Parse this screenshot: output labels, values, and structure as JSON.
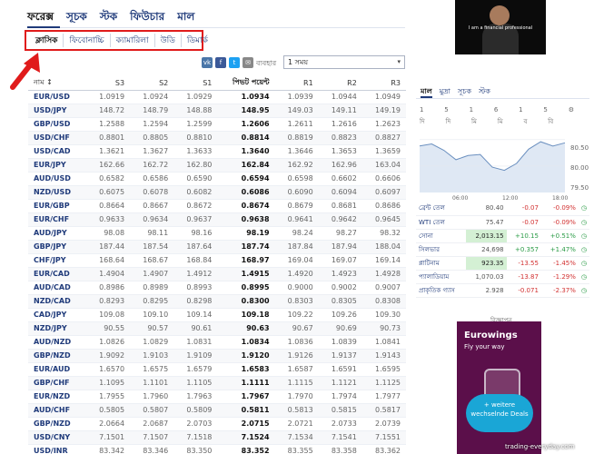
{
  "nav": {
    "tabs": [
      "ফরেক্স",
      "সূচক",
      "স্টক",
      "ফিউচার",
      "মাল"
    ]
  },
  "subtabs": [
    "ক্লাসিক",
    "ফিবোনাচ্চি",
    "ক্যামারিলা",
    "উডি",
    "ডিমার্ক"
  ],
  "share": {
    "label": "ব্যবহার",
    "vk": "vk",
    "fb": "f",
    "tw": "t",
    "mail": "✉"
  },
  "period": {
    "value": "1 সময়"
  },
  "table": {
    "headers": [
      "নাম ↕",
      "S3",
      "S2",
      "S1",
      "পিভট পয়েন্ট",
      "R1",
      "R2",
      "R3"
    ],
    "rows": [
      [
        "EUR/USD",
        "1.0919",
        "1.0924",
        "1.0929",
        "1.0934",
        "1.0939",
        "1.0944",
        "1.0949"
      ],
      [
        "USD/JPY",
        "148.72",
        "148.79",
        "148.88",
        "148.95",
        "149.03",
        "149.11",
        "149.19"
      ],
      [
        "GBP/USD",
        "1.2588",
        "1.2594",
        "1.2599",
        "1.2606",
        "1.2611",
        "1.2616",
        "1.2623"
      ],
      [
        "USD/CHF",
        "0.8801",
        "0.8805",
        "0.8810",
        "0.8814",
        "0.8819",
        "0.8823",
        "0.8827"
      ],
      [
        "USD/CAD",
        "1.3621",
        "1.3627",
        "1.3633",
        "1.3640",
        "1.3646",
        "1.3653",
        "1.3659"
      ],
      [
        "EUR/JPY",
        "162.66",
        "162.72",
        "162.80",
        "162.84",
        "162.92",
        "162.96",
        "163.04"
      ],
      [
        "AUD/USD",
        "0.6582",
        "0.6586",
        "0.6590",
        "0.6594",
        "0.6598",
        "0.6602",
        "0.6606"
      ],
      [
        "NZD/USD",
        "0.6075",
        "0.6078",
        "0.6082",
        "0.6086",
        "0.6090",
        "0.6094",
        "0.6097"
      ],
      [
        "EUR/GBP",
        "0.8664",
        "0.8667",
        "0.8672",
        "0.8674",
        "0.8679",
        "0.8681",
        "0.8686"
      ],
      [
        "EUR/CHF",
        "0.9633",
        "0.9634",
        "0.9637",
        "0.9638",
        "0.9641",
        "0.9642",
        "0.9645"
      ],
      [
        "AUD/JPY",
        "98.08",
        "98.11",
        "98.16",
        "98.19",
        "98.24",
        "98.27",
        "98.32"
      ],
      [
        "GBP/JPY",
        "187.44",
        "187.54",
        "187.64",
        "187.74",
        "187.84",
        "187.94",
        "188.04"
      ],
      [
        "CHF/JPY",
        "168.64",
        "168.67",
        "168.84",
        "168.97",
        "169.04",
        "169.07",
        "169.14"
      ],
      [
        "EUR/CAD",
        "1.4904",
        "1.4907",
        "1.4912",
        "1.4915",
        "1.4920",
        "1.4923",
        "1.4928"
      ],
      [
        "AUD/CAD",
        "0.8986",
        "0.8989",
        "0.8993",
        "0.8995",
        "0.9000",
        "0.9002",
        "0.9007"
      ],
      [
        "NZD/CAD",
        "0.8293",
        "0.8295",
        "0.8298",
        "0.8300",
        "0.8303",
        "0.8305",
        "0.8308"
      ],
      [
        "CAD/JPY",
        "109.08",
        "109.10",
        "109.14",
        "109.18",
        "109.22",
        "109.26",
        "109.30"
      ],
      [
        "NZD/JPY",
        "90.55",
        "90.57",
        "90.61",
        "90.63",
        "90.67",
        "90.69",
        "90.73"
      ],
      [
        "AUD/NZD",
        "1.0826",
        "1.0829",
        "1.0831",
        "1.0834",
        "1.0836",
        "1.0839",
        "1.0841"
      ],
      [
        "GBP/NZD",
        "1.9092",
        "1.9103",
        "1.9109",
        "1.9120",
        "1.9126",
        "1.9137",
        "1.9143"
      ],
      [
        "EUR/AUD",
        "1.6570",
        "1.6575",
        "1.6579",
        "1.6583",
        "1.6587",
        "1.6591",
        "1.6595"
      ],
      [
        "GBP/CHF",
        "1.1095",
        "1.1101",
        "1.1105",
        "1.1111",
        "1.1115",
        "1.1121",
        "1.1125"
      ],
      [
        "EUR/NZD",
        "1.7955",
        "1.7960",
        "1.7963",
        "1.7967",
        "1.7970",
        "1.7974",
        "1.7977"
      ],
      [
        "AUD/CHF",
        "0.5805",
        "0.5807",
        "0.5809",
        "0.5811",
        "0.5813",
        "0.5815",
        "0.5817"
      ],
      [
        "GBP/NZD",
        "2.0664",
        "2.0687",
        "2.0703",
        "2.0715",
        "2.0721",
        "2.0733",
        "2.0739"
      ],
      [
        "USD/CNY",
        "7.1501",
        "7.1507",
        "7.1518",
        "7.1524",
        "7.1534",
        "7.1541",
        "7.1551"
      ],
      [
        "USD/INR",
        "83.342",
        "83.346",
        "83.350",
        "83.352",
        "83.355",
        "83.358",
        "83.362"
      ]
    ]
  },
  "right": {
    "video_caption": "I am a financial professional",
    "tabs": [
      "মাল",
      "মুদ্রা",
      "সূচক",
      "স্টক"
    ],
    "periods_top": [
      "1",
      "5",
      "1",
      "6",
      "1",
      "5",
      ""
    ],
    "periods_bottom": [
      "দি",
      "দি",
      "মি",
      "মি",
      "ব",
      "বি",
      ""
    ],
    "chart_labels": {
      "y_high": "80.50",
      "y_mid": "80.00",
      "y_low": "79.50",
      "x_mid": "06:00",
      "x_end": "12:00",
      "x_right": "18:00"
    },
    "chart_data": {
      "type": "line",
      "x": [
        "06:00",
        "12:00",
        "18:00"
      ],
      "series": [
        {
          "values": [
            80.38,
            80.42,
            80.3,
            80.12,
            80.2,
            80.22,
            79.98,
            79.92,
            80.05,
            80.32,
            80.46,
            80.38,
            80.44
          ]
        }
      ],
      "ylim": [
        79.5,
        80.6
      ]
    },
    "commodities": [
      {
        "name": "ব্রেন্ট তেল",
        "price": "80.40",
        "chg": "-0.07",
        "pct": "-0.09%",
        "dir": "neg",
        "hl": false
      },
      {
        "name": "WTI তেল",
        "price": "75.47",
        "chg": "-0.07",
        "pct": "-0.09%",
        "dir": "neg",
        "hl": false
      },
      {
        "name": "সোনা",
        "price": "2,013.15",
        "chg": "+10.15",
        "pct": "+0.51%",
        "dir": "pos",
        "hl": true
      },
      {
        "name": "সিলভার",
        "price": "24,698",
        "chg": "+0.357",
        "pct": "+1.47%",
        "dir": "pos",
        "hl": false
      },
      {
        "name": "প্লাটিনাম",
        "price": "923.35",
        "chg": "-13.55",
        "pct": "-1.45%",
        "dir": "neg",
        "hl": true
      },
      {
        "name": "প্যালাডিয়াম",
        "price": "1,070.03",
        "chg": "-13.87",
        "pct": "-1.29%",
        "dir": "neg",
        "hl": false
      },
      {
        "name": "প্রাকৃতিক গ্যাস",
        "price": "2.928",
        "chg": "-0.071",
        "pct": "-2.37%",
        "dir": "neg",
        "hl": false
      }
    ],
    "ad_label": "বিজ্ঞাপন",
    "ad": {
      "brand": "Eurowings",
      "tagline": "Fly your way",
      "cta": "+ weitere wechselnde Deals"
    }
  },
  "watermark": "trading-everyday.com"
}
